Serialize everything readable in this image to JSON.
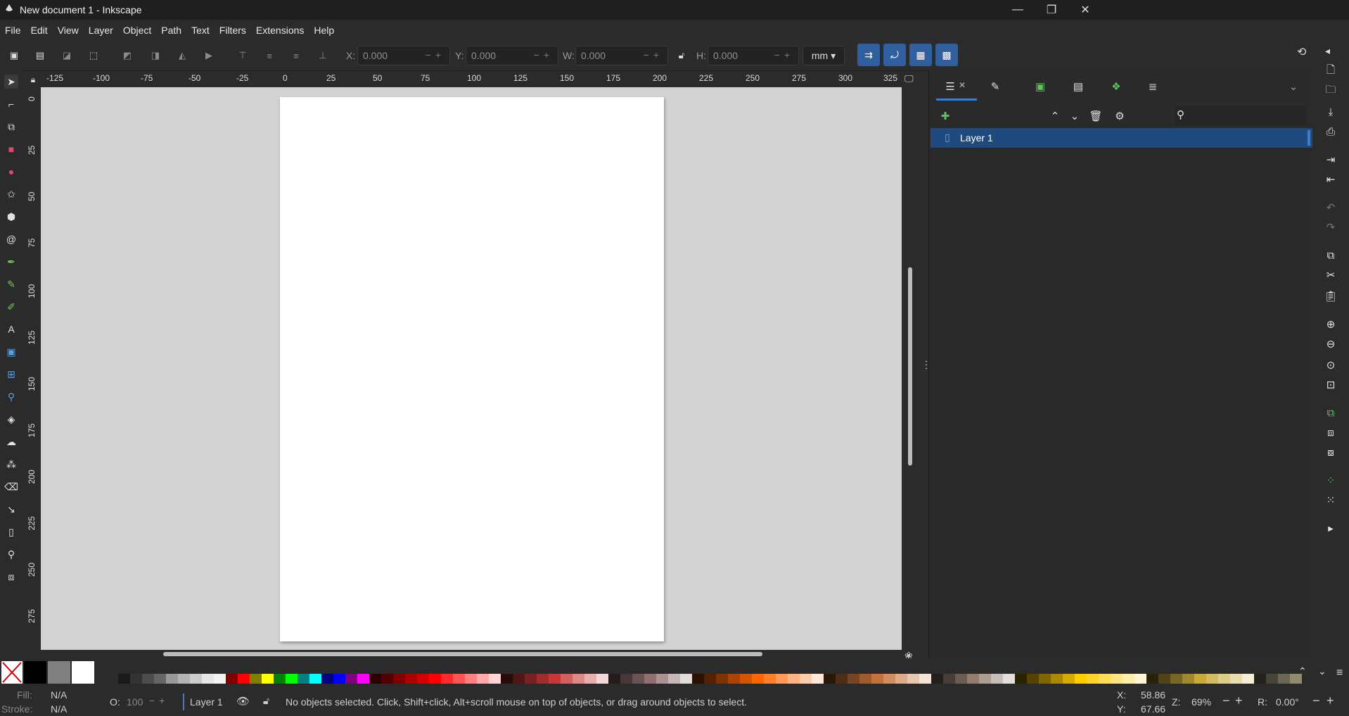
{
  "window": {
    "title": "New document 1 - Inkscape",
    "min": "—",
    "max": "❐",
    "close": "✕"
  },
  "menu": [
    "File",
    "Edit",
    "View",
    "Layer",
    "Object",
    "Path",
    "Text",
    "Filters",
    "Extensions",
    "Help"
  ],
  "toolbar": {
    "x_label": "X:",
    "x_value": "0.000",
    "y_label": "Y:",
    "y_value": "0.000",
    "w_label": "W:",
    "w_value": "0.000",
    "h_label": "H:",
    "h_value": "0.000",
    "unit": "mm",
    "pm": "−+"
  },
  "ruler": {
    "h_labels": [
      "-125",
      "-100",
      "-75",
      "-50",
      "-25",
      "0",
      "25",
      "50",
      "75",
      "100",
      "125",
      "150",
      "175",
      "200",
      "225",
      "250",
      "275",
      "300",
      "325"
    ],
    "v_labels": [
      "0",
      "25",
      "50",
      "75",
      "100",
      "125",
      "150",
      "175",
      "200",
      "225",
      "250",
      "275"
    ]
  },
  "layers_panel": {
    "layer_name": "Layer 1"
  },
  "status": {
    "fill_label": "Fill:",
    "fill_value": "N/A",
    "stroke_label": "Stroke:",
    "stroke_value": "N/A",
    "opacity_label": "O:",
    "opacity_value": "100",
    "layer_name": "Layer 1",
    "message": "No objects selected. Click, Shift+click, Alt+scroll mouse on top of objects, or drag around objects to select.",
    "x_label": "X:",
    "x_value": "58.86",
    "y_label": "Y:",
    "y_value": "67.66",
    "zoom_label": "Z:",
    "zoom_value": "69%",
    "rotation_label": "R:",
    "rotation_value": "0.00°"
  },
  "palette": {
    "big": [
      "#000000",
      "#808080",
      "#ffffff"
    ],
    "colors": [
      "#1a1a1a",
      "#333333",
      "#4d4d4d",
      "#666666",
      "#999999",
      "#b3b3b3",
      "#cccccc",
      "#e6e6e6",
      "#f2f2f2",
      "#800000",
      "#ff0000",
      "#808000",
      "#ffff00",
      "#008000",
      "#00ff00",
      "#008080",
      "#00ffff",
      "#000080",
      "#0000ff",
      "#800080",
      "#ff00ff",
      "#2b0000",
      "#550000",
      "#800000",
      "#aa0000",
      "#d40000",
      "#ff0000",
      "#ff2a2a",
      "#ff5555",
      "#ff8080",
      "#ffaaaa",
      "#ffd5d5",
      "#280b0b",
      "#501616",
      "#782121",
      "#a02c2c",
      "#c83737",
      "#d35f5f",
      "#de8787",
      "#e9afaf",
      "#f4d7d7",
      "#241c1c",
      "#483737",
      "#6c5353",
      "#916f6f",
      "#ac9393",
      "#c8b7b7",
      "#e3dbdb",
      "#2b1100",
      "#552200",
      "#803300",
      "#aa4400",
      "#d45500",
      "#ff6600",
      "#ff7f2a",
      "#ff9955",
      "#ffb380",
      "#ffccaa",
      "#ffe6d5",
      "#28170b",
      "#502d16",
      "#784421",
      "#a05a2c",
      "#c87137",
      "#d38d5f",
      "#deaa87",
      "#e9c6af",
      "#f4e3d7",
      "#241f1c",
      "#483e37",
      "#6c5d53",
      "#917c6f",
      "#ac9d93",
      "#c8beb7",
      "#e3dedb",
      "#2b2200",
      "#554400",
      "#806600",
      "#aa8800",
      "#d4aa00",
      "#ffcc00",
      "#ffd42a",
      "#ffdd55",
      "#ffe680",
      "#ffeeaa",
      "#fff6d5",
      "#28220b",
      "#504416",
      "#786721",
      "#a0892c",
      "#c8ab37",
      "#d3bc5f",
      "#decd87",
      "#e9ddaf",
      "#f4eed7",
      "#24221c",
      "#484537",
      "#6c6753",
      "#918a6f"
    ]
  }
}
